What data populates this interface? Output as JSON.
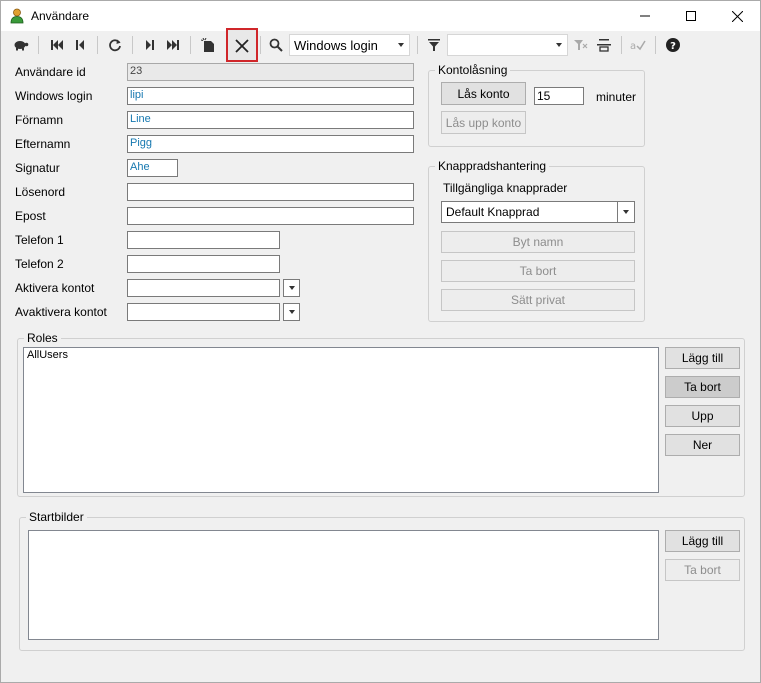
{
  "window": {
    "title": "Användare"
  },
  "toolbar": {
    "search_field_value": "Windows login",
    "filter_value": ""
  },
  "form": {
    "fields": [
      {
        "label": "Användare id",
        "value": "23"
      },
      {
        "label": "Windows login",
        "value": "lipi"
      },
      {
        "label": "Förnamn",
        "value": "Line"
      },
      {
        "label": "Efternamn",
        "value": "Pigg"
      },
      {
        "label": "Signatur",
        "value": "Ahe"
      },
      {
        "label": "Lösenord",
        "value": ""
      },
      {
        "label": "Epost",
        "value": ""
      },
      {
        "label": "Telefon 1",
        "value": ""
      },
      {
        "label": "Telefon 2",
        "value": ""
      },
      {
        "label": "Aktivera kontot",
        "value": ""
      },
      {
        "label": "Avaktivera kontot",
        "value": ""
      }
    ]
  },
  "lock": {
    "group_title": "Kontolåsning",
    "lock_button": "Lås konto",
    "minutes_value": "15",
    "minutes_label": "minuter",
    "unlock_button": "Lås upp konto"
  },
  "buttonrows": {
    "group_title": "Knappradshantering",
    "available_label": "Tillgängliga knapprader",
    "selected": "Default Knapprad",
    "rename_button": "Byt namn",
    "delete_button": "Ta bort",
    "private_button": "Sätt privat"
  },
  "roles": {
    "group_title": "Roles",
    "items": [
      "AllUsers"
    ],
    "add_button": "Lägg till",
    "remove_button": "Ta bort",
    "up_button": "Upp",
    "down_button": "Ner"
  },
  "startbilder": {
    "group_title": "Startbilder",
    "items": [],
    "add_button": "Lägg till",
    "remove_button": "Ta bort"
  },
  "colors": {
    "field_text": "#1678b0",
    "highlight_border": "#d0262a"
  }
}
